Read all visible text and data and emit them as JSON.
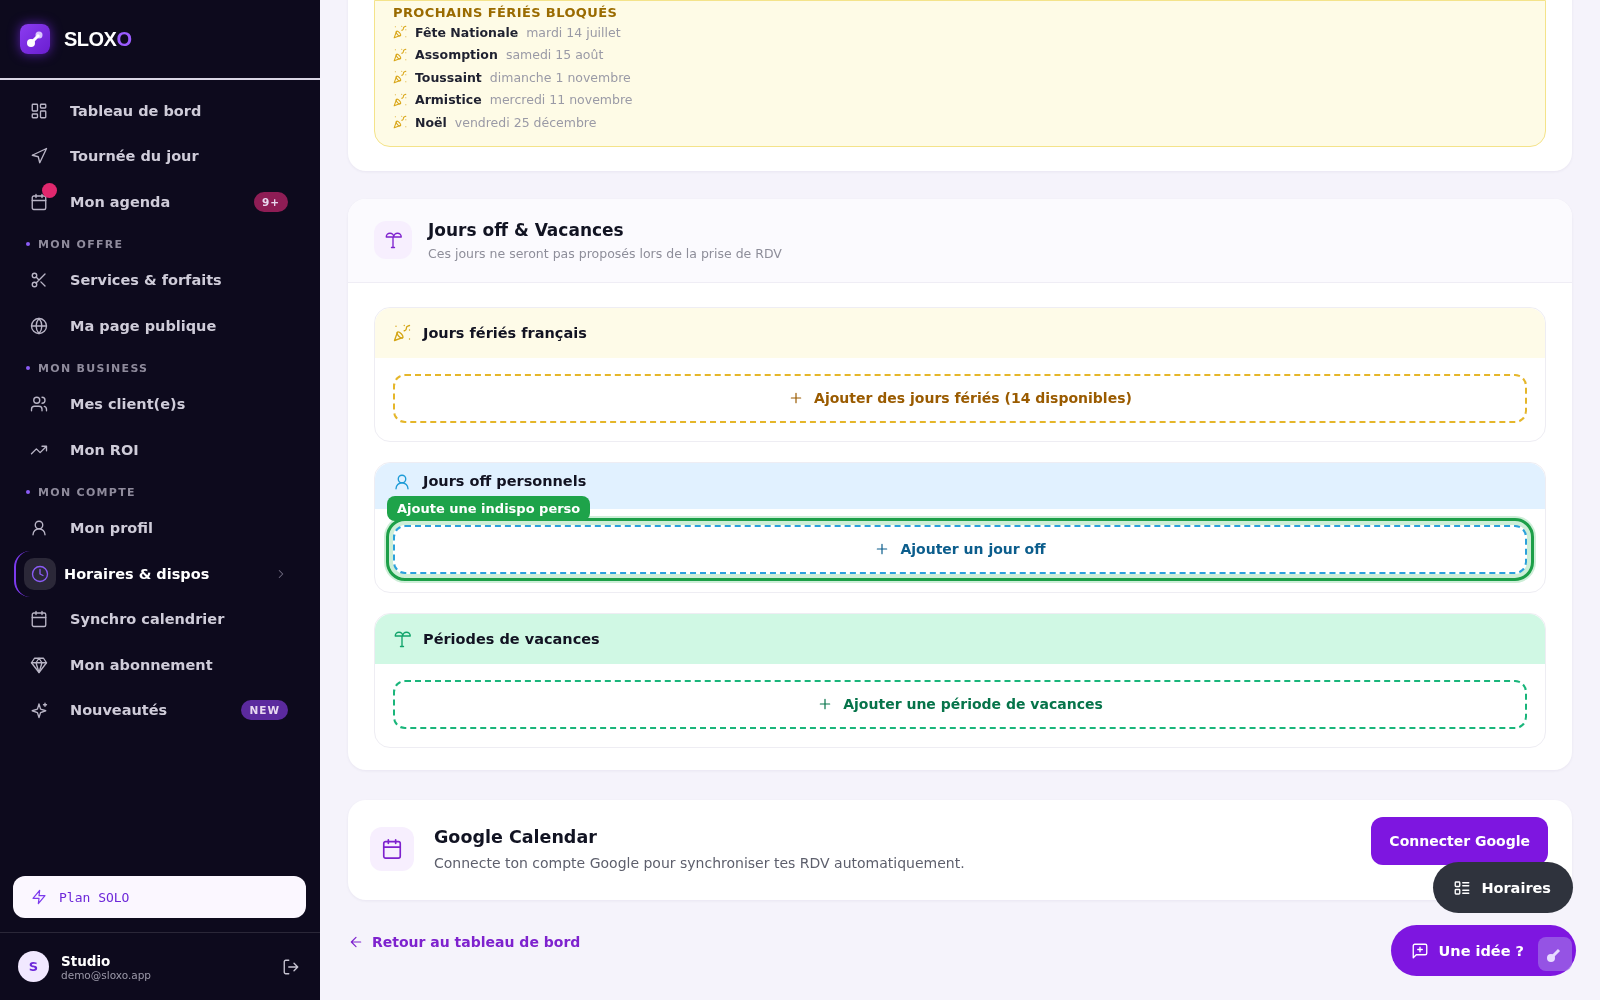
{
  "brand": {
    "name": "SLOX",
    "accent": "O"
  },
  "sidebar": {
    "groups": [
      {
        "items": [
          {
            "label": "Tableau de bord",
            "selected": false,
            "notified": false
          },
          {
            "label": "Tournée du jour",
            "selected": false,
            "notified": false
          },
          {
            "label": "Mon agenda",
            "selected": false,
            "notified": true,
            "badge": {
              "text": "9+",
              "color": "#8e1d55"
            }
          }
        ]
      },
      {
        "label": "MON OFFRE",
        "items": [
          {
            "label": "Services & forfaits",
            "selected": false,
            "notified": false
          },
          {
            "label": "Ma page publique",
            "selected": false,
            "notified": false
          }
        ]
      },
      {
        "label": "MON BUSINESS",
        "items": [
          {
            "label": "Mes client(e)s",
            "selected": false,
            "notified": false
          },
          {
            "label": "Mon ROI",
            "selected": false,
            "notified": false
          }
        ]
      },
      {
        "label": "MON COMPTE",
        "items": [
          {
            "label": "Mon profil",
            "selected": false,
            "notified": false
          },
          {
            "label": "Horaires & dispos",
            "selected": true,
            "notified": false
          },
          {
            "label": "Synchro calendrier",
            "selected": false,
            "notified": false
          },
          {
            "label": "Mon abonnement",
            "selected": false,
            "notified": false
          },
          {
            "label": "Nouveautés",
            "selected": false,
            "notified": false,
            "badge": {
              "text": "NEW",
              "color": "#5b2a9e"
            }
          }
        ]
      }
    ],
    "plan": "Plan SOLO",
    "user": {
      "initial": "S",
      "name": "Studio",
      "email": "demo@sloxo.app"
    }
  },
  "holidays": {
    "title": "PROCHAINS FÉRIÉS BLOQUÉS",
    "items": [
      {
        "name": "Fête Nationale",
        "date": "mardi 14 juillet"
      },
      {
        "name": "Assomption",
        "date": "samedi 15 août"
      },
      {
        "name": "Toussaint",
        "date": "dimanche 1 novembre"
      },
      {
        "name": "Armistice",
        "date": "mercredi 11 novembre"
      },
      {
        "name": "Noël",
        "date": "vendredi 25 décembre"
      }
    ]
  },
  "days_off": {
    "title": "Jours off & Vacances",
    "subtitle": "Ces jours ne seront pas proposés lors de la prise de RDV",
    "sections": [
      {
        "kind": "holidays",
        "title": "Jours fériés français",
        "action": "Ajouter des jours fériés (14 disponibles)",
        "highlighted": false
      },
      {
        "kind": "personal",
        "title": "Jours off personnels",
        "action": "Ajouter un jour off",
        "highlighted": true,
        "tooltip": "Ajoute une indispo perso"
      },
      {
        "kind": "vacation",
        "title": "Périodes de vacances",
        "action": "Ajouter une période de vacances",
        "highlighted": false
      }
    ]
  },
  "google": {
    "title": "Google Calendar",
    "description": "Connecte ton compte Google pour synchroniser tes RDV automatiquement.",
    "button": "Connecter Google"
  },
  "back_link": "Retour au tableau de bord",
  "floating": [
    {
      "kind": "schedule",
      "label": "Horaires"
    },
    {
      "kind": "idea",
      "label": "Une idée ?"
    }
  ]
}
